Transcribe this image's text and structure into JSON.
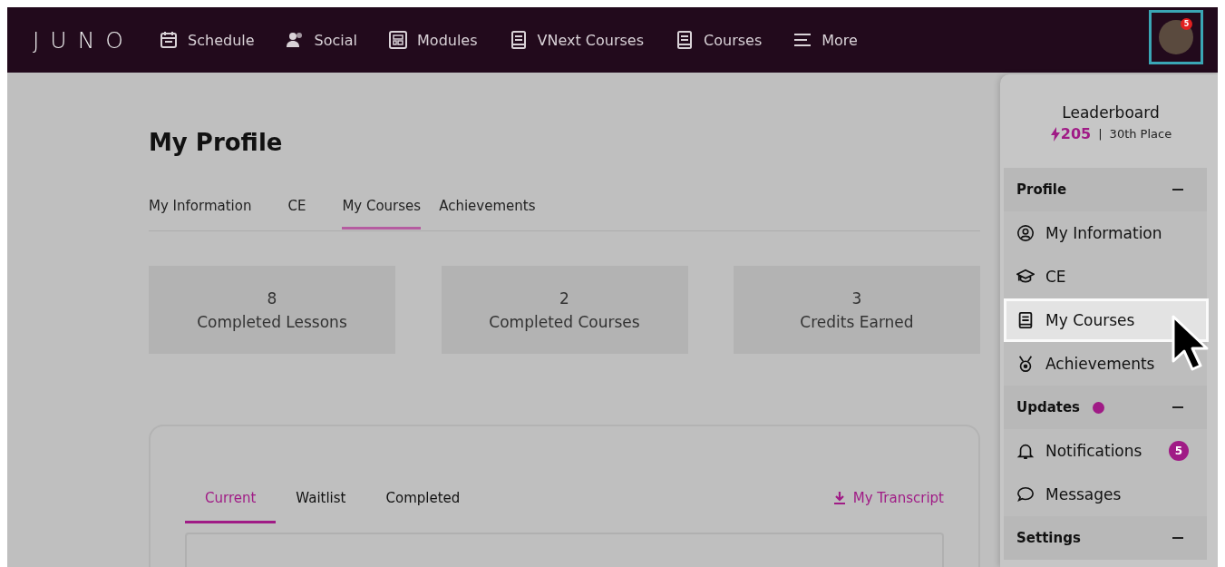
{
  "nav": {
    "logo": "JUNO",
    "items": [
      {
        "label": "Schedule",
        "kind": "calendar"
      },
      {
        "label": "Social",
        "kind": "people"
      },
      {
        "label": "Modules",
        "kind": "grid"
      },
      {
        "label": "VNext Courses",
        "kind": "book"
      },
      {
        "label": "Courses",
        "kind": "book"
      },
      {
        "label": "More",
        "kind": "menu"
      }
    ],
    "avatar_badge": "5"
  },
  "profile": {
    "title": "My Profile",
    "tabs": [
      {
        "label": "My Information",
        "selected": false
      },
      {
        "label": "CE",
        "selected": false
      },
      {
        "label": "My Courses",
        "selected": true
      },
      {
        "label": "Achievements",
        "selected": false
      }
    ],
    "stats": [
      {
        "value": "8",
        "label": "Completed Lessons"
      },
      {
        "value": "2",
        "label": "Completed Courses"
      },
      {
        "value": "3",
        "label": "Credits Earned"
      }
    ],
    "course_tabs": [
      {
        "label": "Current",
        "selected": true
      },
      {
        "label": "Waitlist",
        "selected": false
      },
      {
        "label": "Completed",
        "selected": false
      }
    ],
    "transcript_link": "My Transcript"
  },
  "menu": {
    "leaderboard_title": "Leaderboard",
    "points": "205",
    "separator": "|",
    "place": "30th Place",
    "sections": [
      {
        "title": "Profile",
        "expanded": true,
        "indicator": false,
        "items": [
          {
            "label": "My Information",
            "kind": "user",
            "selected": false
          },
          {
            "label": "CE",
            "kind": "cap",
            "selected": false
          },
          {
            "label": "My Courses",
            "kind": "book",
            "selected": true
          },
          {
            "label": "Achievements",
            "kind": "medal",
            "selected": false
          }
        ]
      },
      {
        "title": "Updates",
        "expanded": true,
        "indicator": true,
        "items": [
          {
            "label": "Notifications",
            "kind": "bell",
            "selected": false,
            "badge": "5"
          },
          {
            "label": "Messages",
            "kind": "chat",
            "selected": false
          }
        ]
      },
      {
        "title": "Settings",
        "expanded": true,
        "indicator": false
      }
    ]
  }
}
